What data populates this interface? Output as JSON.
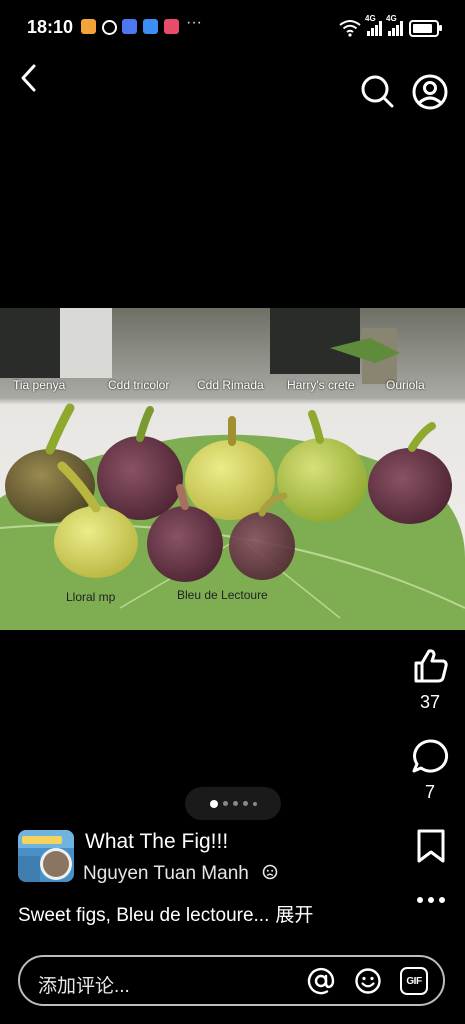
{
  "status_bar": {
    "time": "18:10",
    "ellipsis": "···",
    "network_1": "4G",
    "network_2": "4G",
    "wifi_label": "6",
    "battery_level": 0.85,
    "app_icons": [
      {
        "name": "orange-app-icon",
        "color": "#f3a33a"
      },
      {
        "name": "threads-icon",
        "color": "#ffffff"
      },
      {
        "name": "blue-app-icon",
        "color": "#4a78f0"
      },
      {
        "name": "calendar-app-icon",
        "color": "#3b8ff3"
      },
      {
        "name": "play-app-icon",
        "color": "#e94b6b"
      }
    ]
  },
  "nav": {
    "back_icon": "chevron-left-icon",
    "search_icon": "search-icon",
    "profile_icon": "user-circle-icon"
  },
  "image": {
    "labels": {
      "tia_penya": "Tia penya",
      "cdd_tricolor": "Cdd tricolor",
      "cdd_rimada": "Cdd Rimada",
      "harrys_crete": "Harry's crete",
      "ouriola": "Ouriola",
      "lloral_mp": "Lloral mp",
      "bleu_de_lectoure": "Bleu de Lectoure"
    }
  },
  "actions": {
    "like_count": "37",
    "comment_count": "7"
  },
  "pager": {
    "total": 5,
    "active_index": 0
  },
  "post": {
    "title": "What The Fig!!!",
    "author": "Nguyen Tuan Manh",
    "caption": "Sweet figs, Bleu de lectoure...",
    "expand": "展开"
  },
  "comment": {
    "placeholder": "添加评论...",
    "gif_label": "GIF"
  }
}
